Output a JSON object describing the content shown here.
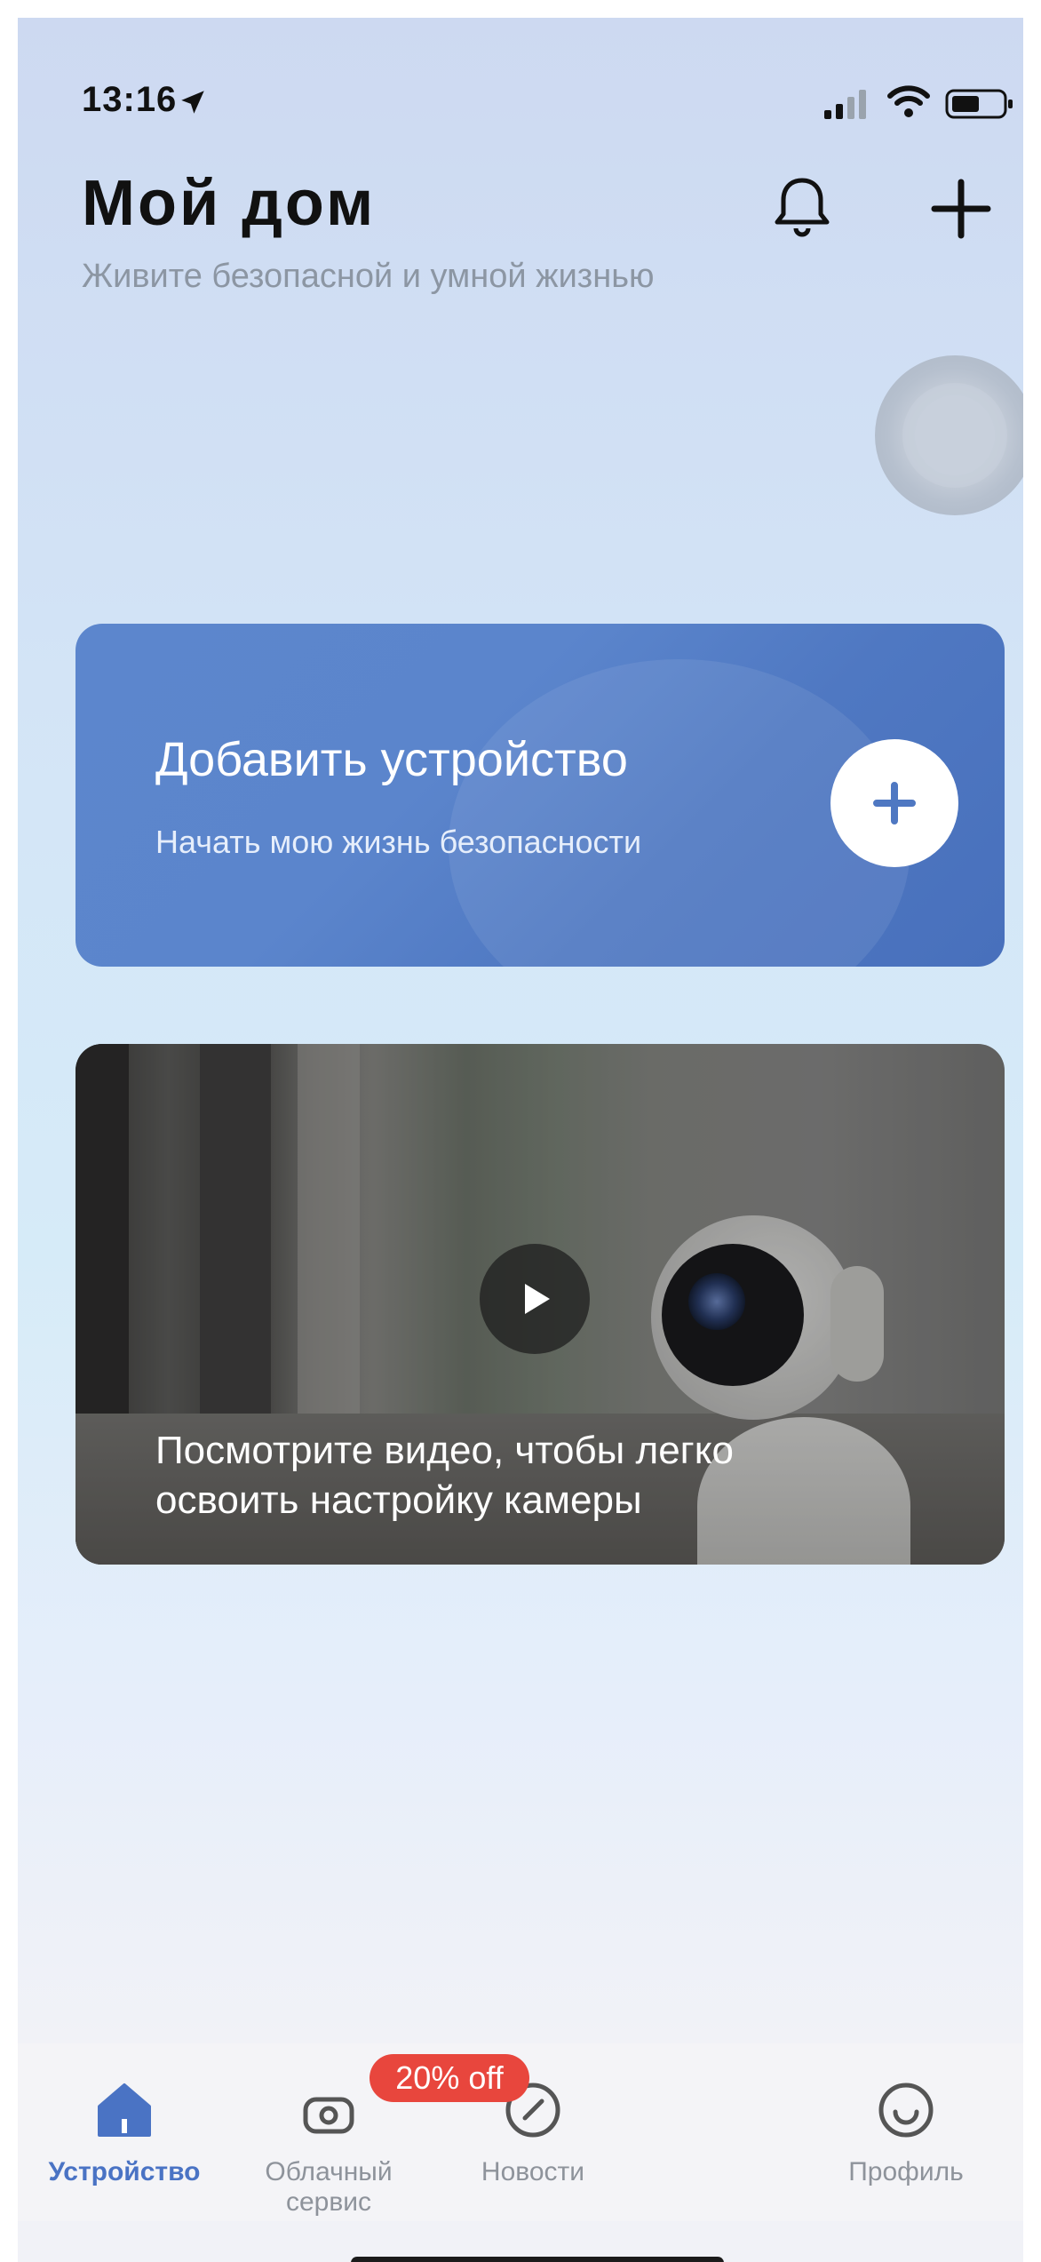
{
  "status_bar": {
    "time": "13:16"
  },
  "header": {
    "title": "Мой дом",
    "subtitle": "Живите безопасной и умной жизнью",
    "icons": [
      "bell-icon",
      "plus-icon"
    ]
  },
  "add_card": {
    "title": "Добавить устройство",
    "subtitle": "Начать мою жизнь безопасности"
  },
  "video_card": {
    "caption": "Посмотрите видео, чтобы легко освоить настройку камеры"
  },
  "tabs": [
    {
      "label": "Устройство",
      "icon": "home-icon",
      "active": true
    },
    {
      "label": "Облачный сервис",
      "icon": "cloud-camera-icon",
      "badge": "20% off"
    },
    {
      "label": "Новости",
      "icon": "compass-icon"
    },
    {
      "label": "Профиль",
      "icon": "smile-icon"
    }
  ],
  "colors": {
    "accent": "#4a73c4",
    "card": "#5b85cc",
    "badge": "#e8463d"
  }
}
